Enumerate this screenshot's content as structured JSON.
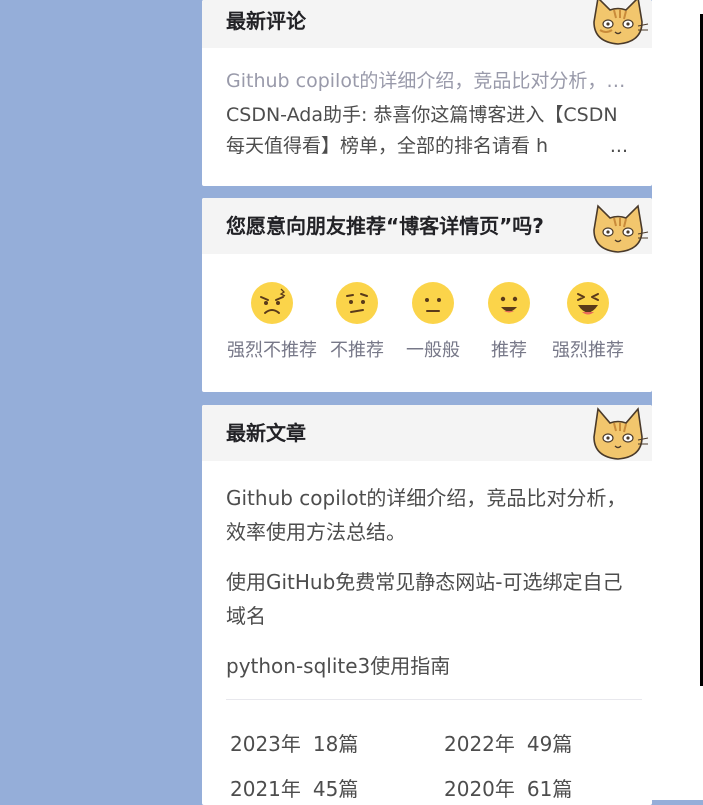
{
  "latest_comments": {
    "title": "最新评论",
    "items": [
      {
        "article": "Github copilot的详细介绍，竞品比对分析，效率使用方法总结。",
        "comment": "CSDN-Ada助手: 恭喜你这篇博客进入【CSDN每天值得看】榜单，全部的排名请看 h"
      }
    ],
    "more": "..."
  },
  "recommend": {
    "title": "您愿意向朋友推荐“博客详情页”吗?",
    "options": [
      {
        "label": "强烈不推荐",
        "icon": "angry-face-icon"
      },
      {
        "label": "不推荐",
        "icon": "frowning-face-icon"
      },
      {
        "label": "一般般",
        "icon": "neutral-face-icon"
      },
      {
        "label": "推荐",
        "icon": "smiling-face-icon"
      },
      {
        "label": "强烈推荐",
        "icon": "laughing-face-icon"
      }
    ]
  },
  "latest_articles": {
    "title": "最新文章",
    "items": [
      "Github copilot的详细介绍，竞品比对分析，效率使用方法总结。",
      "使用GitHub免费常见静态网站-可选绑定自己域名",
      "python-sqlite3使用指南"
    ],
    "archive": [
      {
        "year": "2023年",
        "count": "18篇"
      },
      {
        "year": "2022年",
        "count": "49篇"
      },
      {
        "year": "2021年",
        "count": "45篇"
      },
      {
        "year": "2020年",
        "count": "61篇"
      }
    ]
  },
  "colors": {
    "page_background": "#95aed9",
    "card_header": "#f4f4f4",
    "emoji_yellow": "#fbd44a",
    "muted_text": "#999aaa"
  }
}
